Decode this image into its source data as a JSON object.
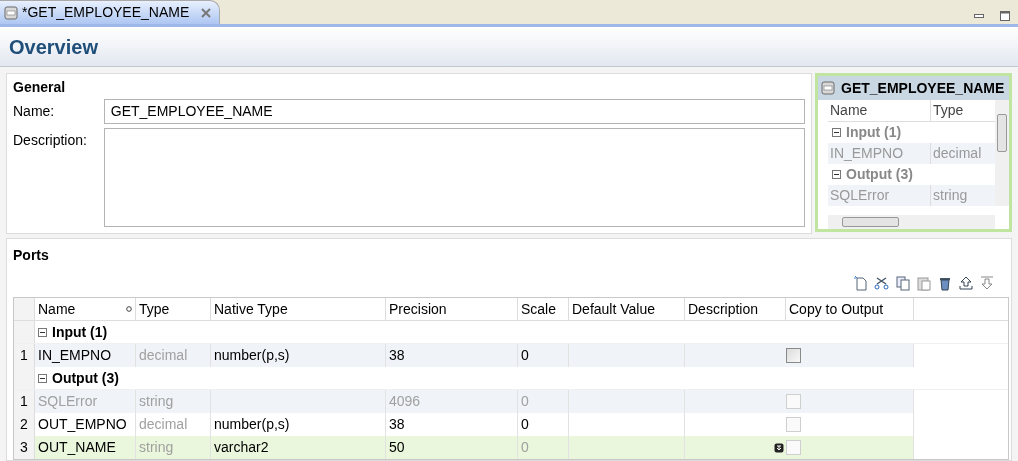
{
  "editor_tab": {
    "title": "*GET_EMPLOYEE_NAME",
    "selected": true
  },
  "page_title": "Overview",
  "general": {
    "heading": "General",
    "name_label": "Name:",
    "name_value": "GET_EMPLOYEE_NAME",
    "description_label": "Description:"
  },
  "preview": {
    "title": "GET_EMPLOYEE_NAME",
    "columns": [
      "Name",
      "Type"
    ],
    "rows": [
      {
        "kind": "group",
        "label": "Input (1)"
      },
      {
        "kind": "port",
        "name": "IN_EMPNO",
        "type": "decimal"
      },
      {
        "kind": "group",
        "label": "Output (3)"
      },
      {
        "kind": "port",
        "name": "SQLError",
        "type": "string"
      }
    ]
  },
  "ports": {
    "heading": "Ports",
    "columns": [
      "Name",
      "Type",
      "Native Type",
      "Precision",
      "Scale",
      "Default Value",
      "Description",
      "Copy to Output"
    ],
    "rows": [
      {
        "kind": "group",
        "label": "Input (1)"
      },
      {
        "kind": "port",
        "number": "1",
        "name": "IN_EMPNO",
        "type": "decimal",
        "native_type": "number(p,s)",
        "precision": "38",
        "scale": "0",
        "disabled": false,
        "scale_disabled": false,
        "selected": false,
        "copy_checked": false,
        "copy_disabled": false
      },
      {
        "kind": "group",
        "label": "Output (3)"
      },
      {
        "kind": "port",
        "number": "1",
        "name": "SQLError",
        "type": "string",
        "precision": "4096",
        "scale": "0",
        "disabled": true,
        "scale_disabled": true,
        "selected": false,
        "copy_checked": false,
        "copy_disabled": true
      },
      {
        "kind": "port",
        "number": "2",
        "name": "OUT_EMPNO",
        "type": "decimal",
        "native_type": "number(p,s)",
        "precision": "38",
        "scale": "0",
        "disabled": false,
        "scale_disabled": false,
        "selected": false,
        "copy_checked": false,
        "copy_disabled": true
      },
      {
        "kind": "port",
        "number": "3",
        "name": "OUT_NAME",
        "type": "string",
        "native_type": "varchar2",
        "precision": "50",
        "scale": "0",
        "disabled": false,
        "scale_disabled": true,
        "selected": true,
        "copy_checked": false,
        "copy_disabled": true
      }
    ]
  }
}
